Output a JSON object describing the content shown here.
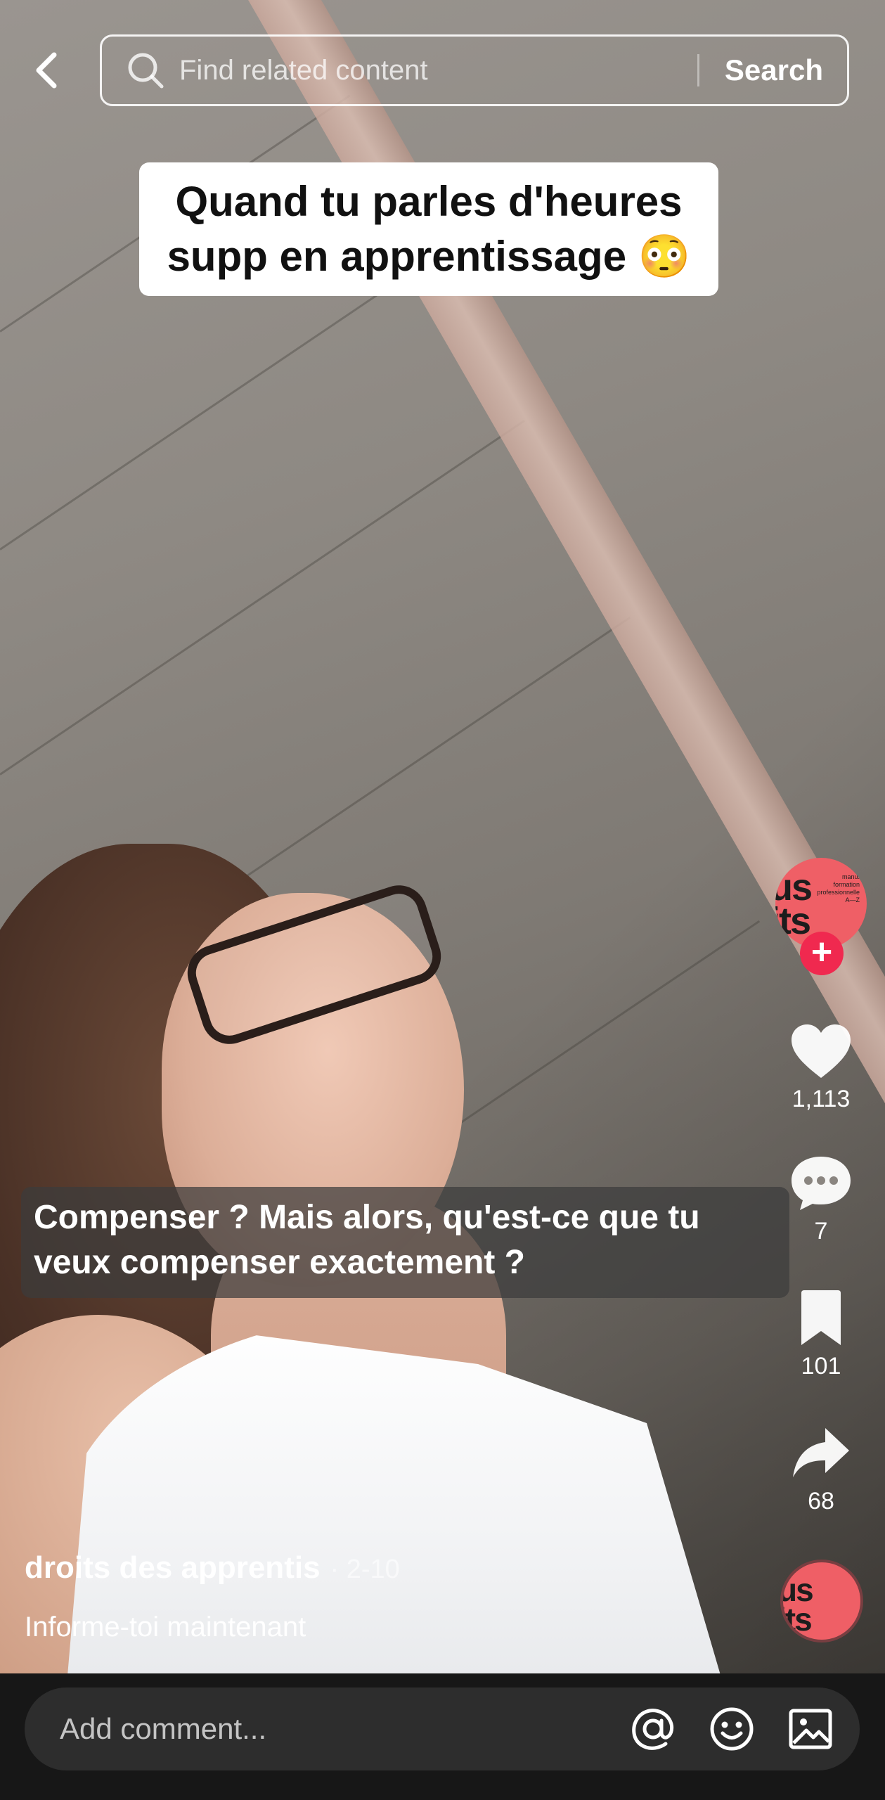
{
  "search": {
    "placeholder": "Find related content",
    "button_label": "Search"
  },
  "caption": {
    "line1": "Quand tu parles d'heures",
    "line2": "supp en apprentissage 😳"
  },
  "subtitle": {
    "line1": "Compenser ? Mais alors, qu'est-ce que tu",
    "line2": "veux compenser exactement ?"
  },
  "avatar": {
    "big_text": "us\nits",
    "small_text": "manu. formation professionnelle A—Z",
    "follow_symbol": "+"
  },
  "actions": {
    "likes": "1,113",
    "comments": "7",
    "saves": "101",
    "shares": "68"
  },
  "post": {
    "author": "droits des apprentis",
    "date": "· 2-10",
    "description": "Informe-toi maintenant"
  },
  "comment": {
    "placeholder": "Add comment..."
  },
  "icons": {
    "back": "chevron-left-icon",
    "search": "search-icon",
    "like": "heart-icon",
    "comment": "comment-bubble-icon",
    "save": "bookmark-icon",
    "share": "share-arrow-icon",
    "mention": "at-sign-icon",
    "emoji": "smiley-icon",
    "image": "image-icon"
  },
  "colors": {
    "accent": "#f0294f",
    "avatar_bg": "#ef5f66"
  }
}
